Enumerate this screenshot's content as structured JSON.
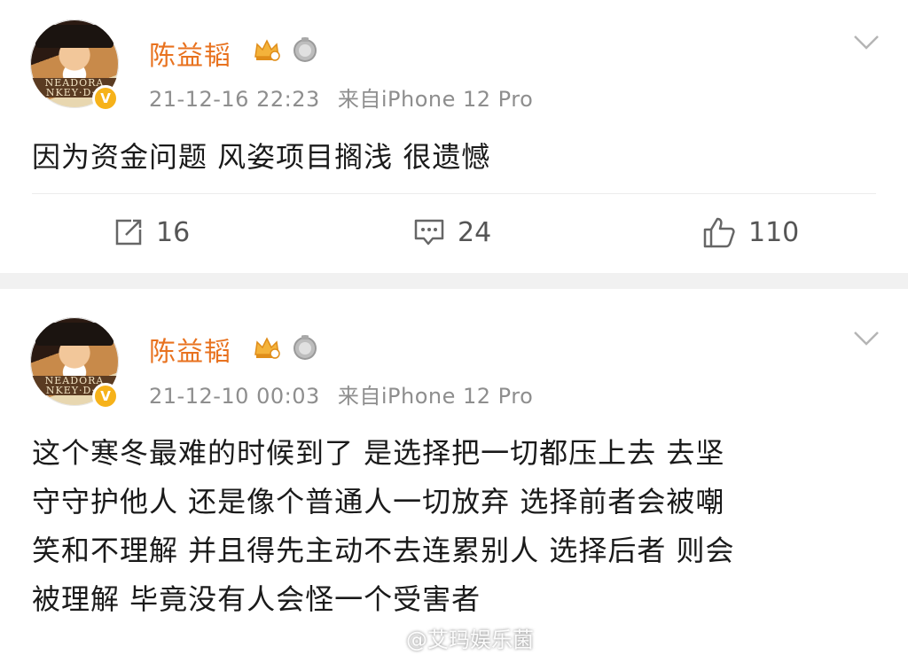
{
  "posts": [
    {
      "author": "陈益韬",
      "avatar_banner": "NEADORA\nNKEY·D·L",
      "verified_mark": "V",
      "timestamp": "21-12-16 22:23",
      "source": "来自iPhone 12 Pro",
      "text": "因为资金问题 风姿项目搁浅 很遗憾",
      "actions": {
        "repost_count": "16",
        "comment_count": "24",
        "like_count": "110"
      }
    },
    {
      "author": "陈益韬",
      "avatar_banner": "NEADORA\nNKEY·D·L",
      "verified_mark": "V",
      "timestamp": "21-12-10 00:03",
      "source": "来自iPhone 12 Pro",
      "lines": [
        "这个寒冬最难的时候到了 是选择把一切都压上去 去坚",
        "守守护他人 还是像个普通人一切放弃 选择前者会被嘲",
        "笑和不理解 并且得先主动不去连累别人 选择后者 则会",
        "被理解 毕竟没有人会怪一个受害者"
      ]
    }
  ],
  "watermark": "@艾玛娱乐菌",
  "icons": {
    "crown": "crown-icon",
    "medal": "medal-icon",
    "chevron": "chevron-down-icon",
    "repost": "repost-icon",
    "comment": "comment-icon",
    "like": "thumbs-up-icon",
    "weibo": "weibo-logo-icon"
  },
  "colors": {
    "author_name": "#e8721f",
    "badge_gold": "#f6b21a",
    "meta_gray": "#8e8e8e"
  }
}
